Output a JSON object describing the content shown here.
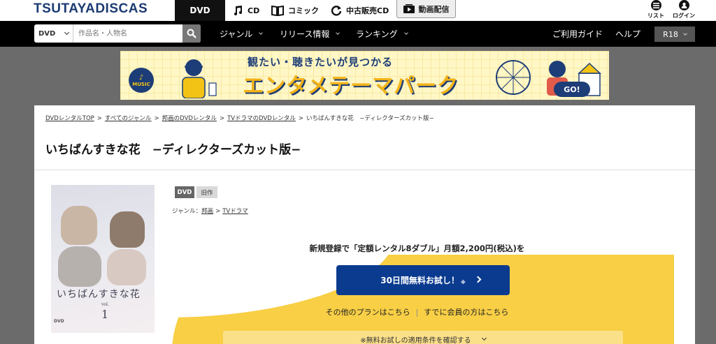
{
  "header": {
    "logo": "TSUTAYADISCAS",
    "tabs": {
      "dvd": "DVD",
      "cd": "CD",
      "comic": "コミック",
      "used_cd": "中古販売CD",
      "video": "動画配信"
    },
    "icons": {
      "list": "リスト",
      "login": "ログイン"
    }
  },
  "nav": {
    "search_category": "DVD",
    "search_placeholder": "作品名・人物名",
    "items": {
      "genre": "ジャンル",
      "release": "リリース情報",
      "ranking": "ランキング",
      "guide": "ご利用ガイド",
      "help": "ヘルプ",
      "r18": "R18"
    }
  },
  "banner": {
    "tagline": "観たい・聴きたいが見つかる",
    "title": "エンタメテーマパーク",
    "badge": "MUSIC",
    "cta": "GO!"
  },
  "breadcrumb": {
    "items": [
      "DVDレンタルTOP",
      "すべてのジャンル",
      "邦画のDVDレンタル",
      "TVドラマのDVDレンタル"
    ],
    "current": "いちばんすきな花　−ディレクターズカット版−"
  },
  "product": {
    "title": "いちばんすきな花　−ディレクターズカット版−",
    "badges": {
      "format": "DVD",
      "release_type": "旧作"
    },
    "genre_label": "ジャンル：",
    "genre_path": [
      "邦画",
      "TVドラマ"
    ],
    "cover": {
      "title": "いちばんすきな花",
      "vol_label": "vol.",
      "vol_number": "1",
      "format": "DVD"
    }
  },
  "promo": {
    "headline": "新規登録で「定額レンタル8ダブル」月額2,200円(税込)を",
    "trial_button": "30日間無料お試し！",
    "trial_note": "※",
    "other_plans": "その他のプランはこちら",
    "member_link": "すでに会員の方はこちら",
    "conditions": "※無料お試しの適用条件を確認する"
  },
  "colors": {
    "brand_navy": "#1c3a73",
    "button_blue": "#0b3b8f",
    "promo_yellow": "#f8cf45",
    "nav_black": "#000000"
  }
}
